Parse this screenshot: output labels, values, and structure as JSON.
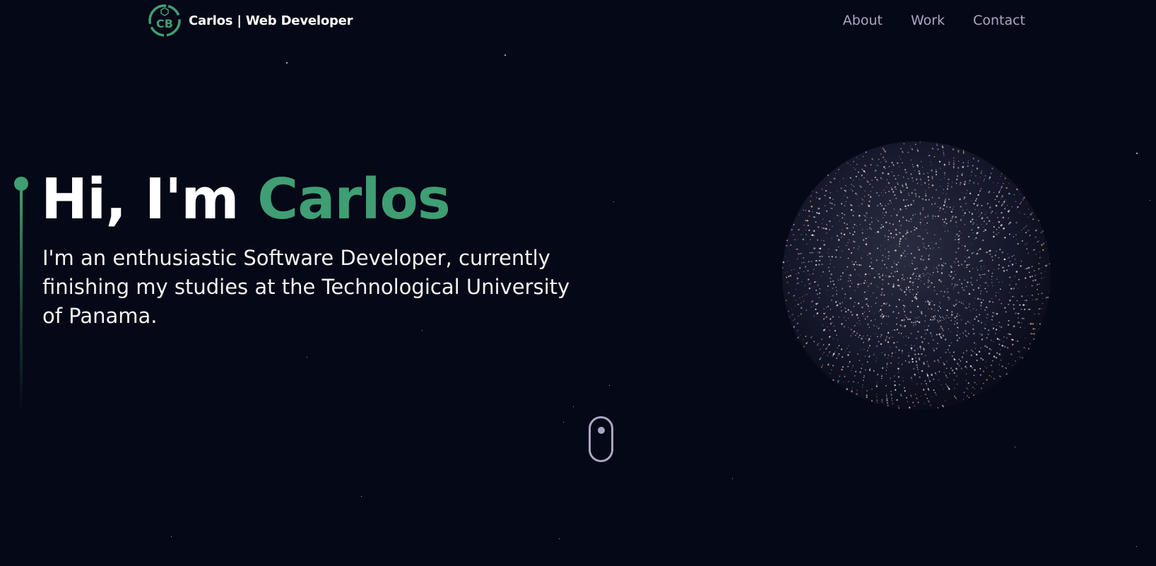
{
  "navbar": {
    "logo_icon": "cb-monogram-logo",
    "logo_initials": "CB",
    "brand": "Carlos | Web Developer",
    "links": [
      {
        "label": "About"
      },
      {
        "label": "Work"
      },
      {
        "label": "Contact"
      }
    ]
  },
  "hero": {
    "greeting": "Hi, I'm",
    "name": "Carlos",
    "subtitle": "I'm an enthusiastic Software Developer, currently finishing my studies at the Technological University of Panama.",
    "accent_color": "#3f9e73",
    "globe_icon": "particle-earth-globe",
    "scroll_icon": "scroll-mouse-icon"
  },
  "theme": {
    "background": "#050816",
    "nav_link_color": "#aaa6c3",
    "text": "#ffffff"
  }
}
